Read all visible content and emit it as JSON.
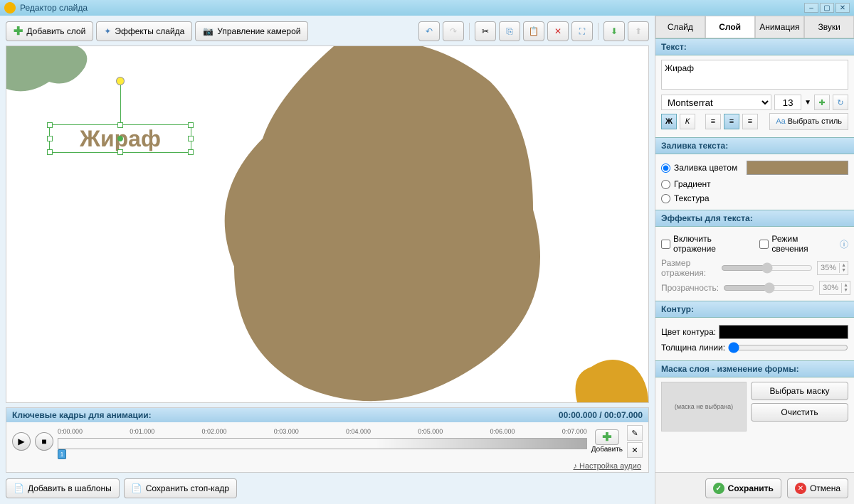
{
  "window": {
    "title": "Редактор слайда"
  },
  "toolbar": {
    "add_layer": "Добавить слой",
    "slide_effects": "Эффекты слайда",
    "camera_control": "Управление камерой"
  },
  "canvas": {
    "text_value": "Жираф"
  },
  "keyframes": {
    "title": "Ключевые кадры для анимации:",
    "time_current": "00:00.000",
    "time_total": "00:07.000",
    "ticks": [
      "0:00.000",
      "0:01.000",
      "0:02.000",
      "0:03.000",
      "0:04.000",
      "0:05.000",
      "0:06.000",
      "0:07.000"
    ],
    "marker_label": "1",
    "add_label": "Добавить",
    "audio_link": "Настройка аудио"
  },
  "bottom": {
    "add_templates": "Добавить в шаблоны",
    "save_frame": "Сохранить стоп-кадр"
  },
  "tabs": {
    "slide": "Слайд",
    "layer": "Слой",
    "animation": "Анимация",
    "sounds": "Звуки"
  },
  "panel": {
    "text_header": "Текст:",
    "text_value": "Жираф",
    "font_name": "Montserrat",
    "font_size": "13",
    "style_button": "Выбрать стиль",
    "fill_header": "Заливка текста:",
    "fill_options": {
      "color": "Заливка цветом",
      "gradient": "Градиент",
      "texture": "Текстура"
    },
    "fill_color": "#a08860",
    "effects_header": "Эффекты для текста:",
    "reflection_enable": "Включить отражение",
    "glow_mode": "Режим свечения",
    "reflection_size_label": "Размер отражения:",
    "reflection_size": "35%",
    "transparency_label": "Прозрачность:",
    "transparency": "30%",
    "contour_header": "Контур:",
    "contour_color_label": "Цвет контура:",
    "contour_color": "#000000",
    "line_width_label": "Толщина линии:",
    "mask_header": "Маска слоя - изменение формы:",
    "mask_placeholder": "(маска не выбрана)",
    "mask_select": "Выбрать маску",
    "mask_clear": "Очистить"
  },
  "footer": {
    "save": "Сохранить",
    "cancel": "Отмена"
  }
}
